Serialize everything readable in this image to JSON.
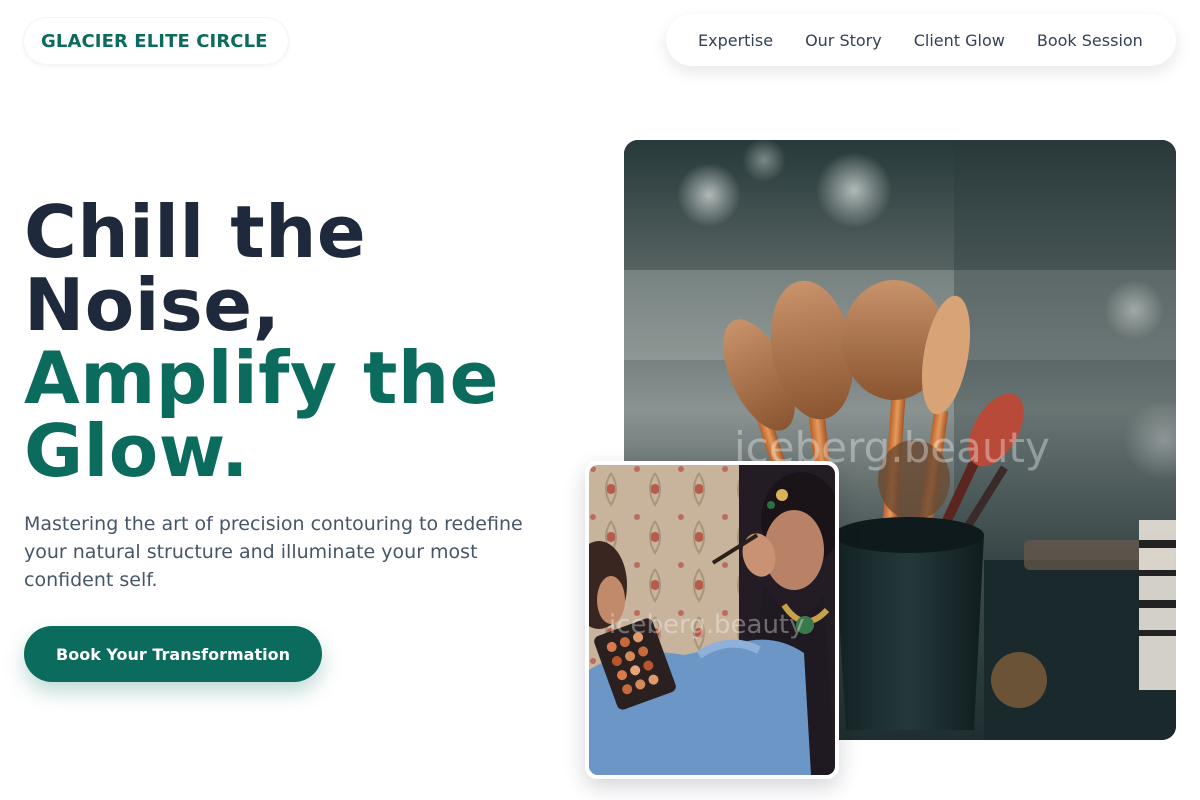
{
  "brand": {
    "name": "GLACIER ELITE CIRCLE"
  },
  "nav": {
    "items": [
      {
        "label": "Expertise"
      },
      {
        "label": "Our Story"
      },
      {
        "label": "Client Glow"
      },
      {
        "label": "Book Session"
      }
    ]
  },
  "hero": {
    "title_line_1": "Chill the",
    "title_line_2": "Noise,",
    "title_line_3": "Amplify the",
    "title_line_4": "Glow.",
    "subtitle": "Mastering the art of precision contouring to redefine your natural structure and illuminate your most confident self.",
    "cta_label": "Book Your Transformation"
  },
  "images": {
    "main_watermark": "iceberg.beauty",
    "inset_watermark": "iceberg.beauty"
  },
  "colors": {
    "accent": "#0b6b5c",
    "heading": "#1e293b",
    "body_text": "#475569"
  }
}
